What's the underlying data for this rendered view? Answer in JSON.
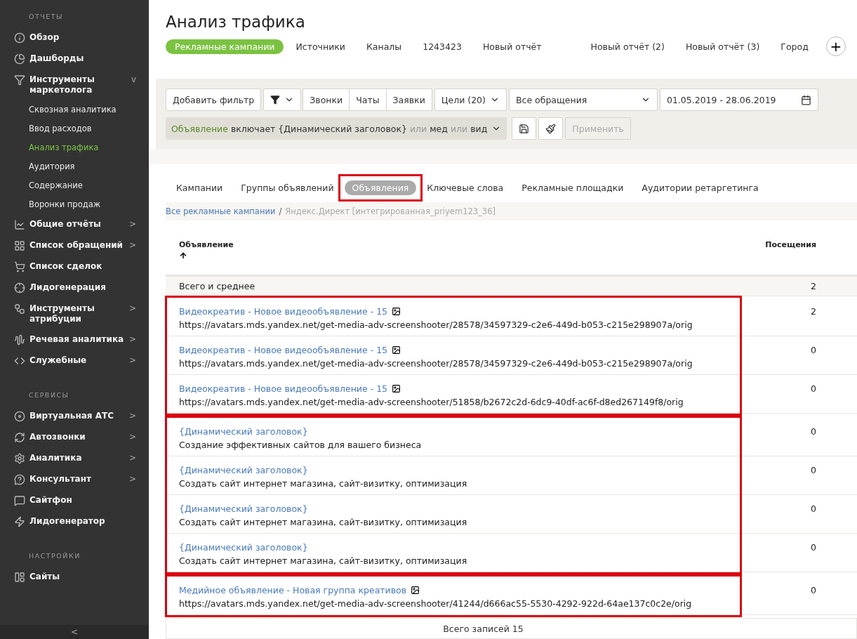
{
  "sidebar": {
    "sections": [
      {
        "title": "ОТЧЕТЫ",
        "items": [
          {
            "label": "Обзор"
          },
          {
            "label": "Дашборды"
          },
          {
            "label": "Инструменты маркетолога",
            "chevron": "v",
            "children": [
              {
                "label": "Сквозная аналитика",
                "selected": false
              },
              {
                "label": "Ввод расходов",
                "selected": false
              },
              {
                "label": "Анализ трафика",
                "selected": true
              },
              {
                "label": "Аудитория",
                "selected": false
              },
              {
                "label": "Содержание",
                "selected": false
              },
              {
                "label": "Воронки продаж",
                "selected": false
              }
            ]
          },
          {
            "label": "Общие отчёты",
            "chevron": ">"
          },
          {
            "label": "Список обращений",
            "chevron": ">"
          },
          {
            "label": "Список сделок"
          },
          {
            "label": "Лидогенерация"
          },
          {
            "label": "Инструменты атрибуции",
            "chevron": ">"
          },
          {
            "label": "Речевая аналитика",
            "chevron": ">"
          },
          {
            "label": "Служебные",
            "chevron": ">"
          }
        ]
      },
      {
        "title": "СЕРВИСЫ",
        "items": [
          {
            "label": "Виртуальная АТС",
            "chevron": ">"
          },
          {
            "label": "Автозвонки",
            "chevron": ">"
          },
          {
            "label": "Аналитика",
            "chevron": ">"
          },
          {
            "label": "Консультант",
            "chevron": ">"
          },
          {
            "label": "Сайтфон"
          },
          {
            "label": "Лидогенератор"
          }
        ]
      },
      {
        "title": "НАСТРОЙКИ",
        "items": [
          {
            "label": "Сайты"
          }
        ]
      }
    ],
    "collapse": "<"
  },
  "header": {
    "title": "Анализ трафика",
    "report_tabs": [
      {
        "label": "Рекламные кампании",
        "selected": true
      },
      {
        "label": "Источники",
        "selected": false
      },
      {
        "label": "Каналы",
        "selected": false
      },
      {
        "label": "1243423",
        "selected": false
      },
      {
        "label": "Новый отчёт",
        "selected": false
      },
      {
        "label": "Новый отчёт (2)",
        "selected": false
      },
      {
        "label": "Новый отчёт (3)",
        "selected": false
      },
      {
        "label": "Город",
        "selected": false
      }
    ],
    "add_button": "+"
  },
  "filters": {
    "add_filter": "Добавить фильтр",
    "types": [
      "Звонки",
      "Чаты",
      "Заявки"
    ],
    "goals": "Цели (20)",
    "appeals": "Все обращения",
    "date": "01.05.2019 - 28.06.2019",
    "expression": [
      {
        "text": "Объявление",
        "kind": "field"
      },
      {
        "text": "включает {Динамический заголовок}",
        "kind": "value"
      },
      {
        "text": "или",
        "kind": "operator"
      },
      {
        "text": "мед",
        "kind": "value"
      },
      {
        "text": "или",
        "kind": "operator"
      },
      {
        "text": "вид",
        "kind": "value"
      }
    ],
    "apply": {
      "label": "Применить",
      "disabled": true
    }
  },
  "level_tabs": [
    {
      "label": "Кампании",
      "selected": false,
      "highlighted": false
    },
    {
      "label": "Группы объявлений",
      "selected": false,
      "highlighted": false
    },
    {
      "label": "Объявления",
      "selected": true,
      "highlighted": true
    },
    {
      "label": "Ключевые слова",
      "selected": false,
      "highlighted": false
    },
    {
      "label": "Рекламные площадки",
      "selected": false,
      "highlighted": false
    },
    {
      "label": "Аудитории ретаргетинга",
      "selected": false,
      "highlighted": false
    }
  ],
  "breadcrumb": {
    "items": [
      "Все рекламные кампании",
      "Яндекс.Директ [интегрированная_priyem123_36]"
    ],
    "separator": "/"
  },
  "table": {
    "columns": [
      "Объявление",
      "Посещения"
    ],
    "total": {
      "label": "Всего и среднее",
      "visits": "2"
    },
    "groups": [
      {
        "highlighted": true,
        "rows": [
          {
            "title": "Видеокреатив - Новое видеообъявление - 15",
            "has_image": true,
            "text": "https://avatars.mds.yandex.net/get-media-adv-screenshooter/28578/34597329-c2e6-449d-b053-c215e298907a/orig",
            "visits": "2"
          },
          {
            "title": "Видеокреатив - Новое видеообъявление - 15",
            "has_image": true,
            "text": "https://avatars.mds.yandex.net/get-media-adv-screenshooter/28578/34597329-c2e6-449d-b053-c215e298907a/orig",
            "visits": "0"
          },
          {
            "title": "Видеокреатив - Новое видеообъявление - 15",
            "has_image": true,
            "text": "https://avatars.mds.yandex.net/get-media-adv-screenshooter/51858/b2672c2d-6dc9-40df-ac6f-d8ed267149f8/orig",
            "visits": "0"
          }
        ]
      },
      {
        "highlighted": true,
        "rows": [
          {
            "title": "{Динамический заголовок}",
            "has_image": false,
            "text": "Создание эффективных сайтов для вашего бизнеса",
            "visits": "0"
          },
          {
            "title": "{Динамический заголовок}",
            "has_image": false,
            "text": "Создать сайт интернет магазина, сайт-визитку, оптимизация",
            "visits": "0"
          },
          {
            "title": "{Динамический заголовок}",
            "has_image": false,
            "text": "Создать сайт интернет магазина, сайт-визитку, оптимизация",
            "visits": "0"
          },
          {
            "title": "{Динамический заголовок}",
            "has_image": false,
            "text": "Создать сайт интернет магазина, сайт-визитку, оптимизация",
            "visits": "0"
          }
        ]
      },
      {
        "highlighted": true,
        "rows": [
          {
            "title": "Медийное объявление - Новая группа креативов",
            "has_image": true,
            "text": "https://avatars.mds.yandex.net/get-media-adv-screenshooter/41244/d666ac55-5530-4292-922d-64ae137c0c2e/orig",
            "visits": "0"
          }
        ]
      }
    ],
    "footer": "Всего записей 15"
  }
}
